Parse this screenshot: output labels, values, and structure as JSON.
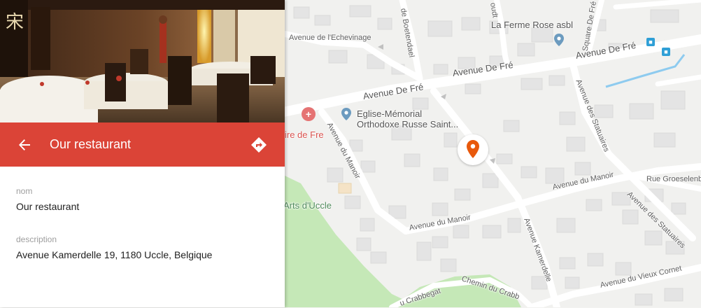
{
  "colors": {
    "accent": "#db4437",
    "marker": "#e8590c",
    "park": "#c5e8b7",
    "road": "#ffffff",
    "water": "#8ecbef"
  },
  "panel": {
    "title": "Our restaurant",
    "back_icon": "arrow-back-icon",
    "directions_icon": "directions-icon",
    "fields": [
      {
        "label": "nom",
        "value": "Our restaurant"
      },
      {
        "label": "description",
        "value": "Avenue Kamerdelle 19, 1180 Uccle, Belgique"
      }
    ]
  },
  "map": {
    "labels": {
      "ferme_rose": "La Ferme Rose asbl",
      "avenue_de_fre_1": "Avenue De Fré",
      "avenue_de_fre_2": "Avenue De Fré",
      "avenue_de_fre_3": "Avenue De Fré",
      "echevinage": "Avenue de l'Echevinage",
      "boetendael": "de Boetendael",
      "oudt": "oudt",
      "square_de_fre": "Square De Fré",
      "eglise": "Eglise-Mémorial\nOrthodoxe Russe Saint...",
      "fre_poi": "ire de Fre",
      "avenue_du_manoir_1": "Avenue du Manoir",
      "avenue_du_manoir_2": "Avenue du Manoir",
      "avenue_du_manoir_3": "Avenue du Manoir",
      "statuaires_1": "Avenue des Statuaires",
      "statuaires_2": "Avenue des Statuaires",
      "groeselenb": "Rue Groeselenbe",
      "kamerdelle": "Avenue Kamerdelle",
      "arts_uccle": "Arts d'Uccle",
      "crabbegat": "u Crabbegat",
      "chemin_crabb": "Chemin du Crabb",
      "vieux_cornet": "Avenue du Vieux Cornet"
    }
  }
}
